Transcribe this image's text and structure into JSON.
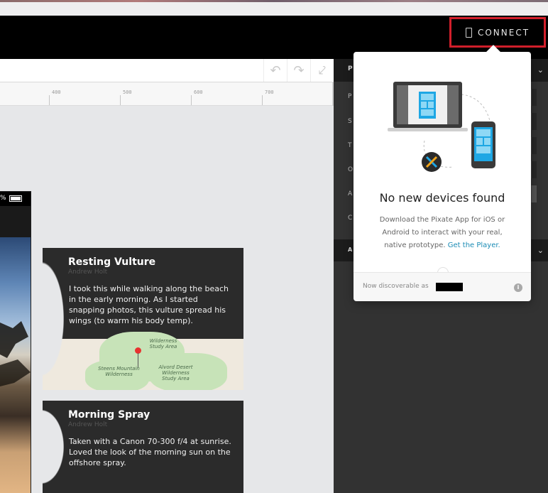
{
  "header": {
    "connect_label": "CONNECT"
  },
  "toolbar": {
    "icons": [
      "undo-icon",
      "redo-icon",
      "pointer-icon"
    ]
  },
  "ruler": {
    "labels": [
      "400",
      "500",
      "600",
      "700"
    ]
  },
  "phone_preview": {
    "battery_text": "%"
  },
  "cards": [
    {
      "title": "Resting Vulture",
      "author": "Andrew Holt",
      "body": "I took this while walking along the beach in the early morning. As I started snapping photos, this vulture spread his wings (to warm his body temp).",
      "map_labels": [
        "Wilderness Study Area",
        "Steens Mountain Wilderness",
        "Alvord Desert Wilderness Study Area"
      ]
    },
    {
      "title": "Morning Spray",
      "author": "Andrew Holt",
      "body": "Taken with a Canon 70-300 f/4 at sunrise. Loved the look of the morning sun on the offshore spray."
    }
  ],
  "right_panel": {
    "header_initial": "P",
    "section2_initial": "A",
    "row_initials": [
      "P",
      "S",
      "T",
      "O",
      "A",
      "C"
    ]
  },
  "popover": {
    "title": "No new devices found",
    "desc_before_link": "Download the Pixate App for iOS or Android to interact with your real, native prototype. ",
    "link": "Get the Player.",
    "discoverable_label": "Now discoverable as",
    "info_glyph": "i"
  },
  "colors": {
    "highlight_border": "#d21f2b",
    "link": "#1a8bb5",
    "device_blue": "#1ea7e4",
    "pixate_orange": "#f2a51a"
  }
}
